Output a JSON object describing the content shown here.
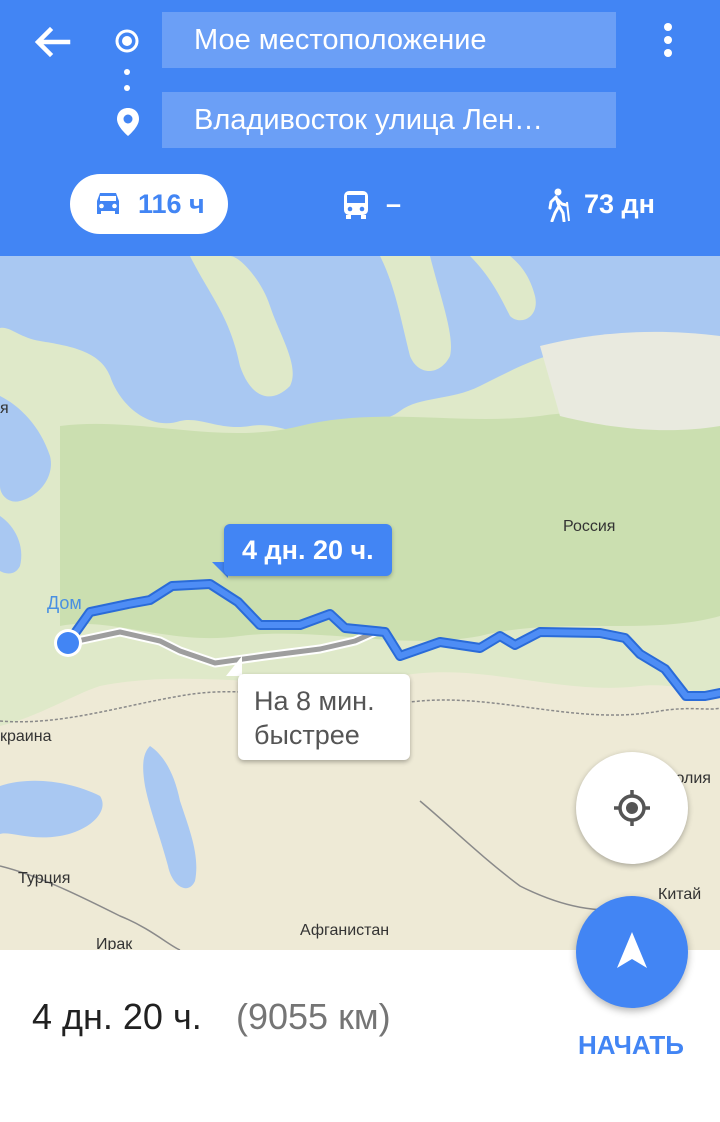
{
  "header": {
    "from_field": "Мое местоположение",
    "to_field": "Владивосток улица Лен…",
    "modes": [
      {
        "icon": "car-icon",
        "label": "116 ч",
        "selected": true
      },
      {
        "icon": "bus-icon",
        "label": "–",
        "selected": false
      },
      {
        "icon": "walk-icon",
        "label": "73 дн",
        "selected": false
      }
    ],
    "accent_color": "#4285f4"
  },
  "map": {
    "labels": {
      "russia": "Россия",
      "home": "Дом",
      "ukraine": "краина",
      "turkey": "Турция",
      "iraq": "Ирак",
      "afghanistan": "Афганистан",
      "china": "Китай",
      "mongolia": "голия",
      "edge_left": "я"
    },
    "route_callout": "4 дн. 20 ч.",
    "alt_callout_line1": "На 8 мин.",
    "alt_callout_line2": "быстрее",
    "route_color": "#4285f4",
    "alt_route_color": "#9e9e9e"
  },
  "bottom": {
    "duration": "4 дн. 20 ч.",
    "distance": "(9055 км)",
    "start_label": "НАЧАТЬ"
  }
}
